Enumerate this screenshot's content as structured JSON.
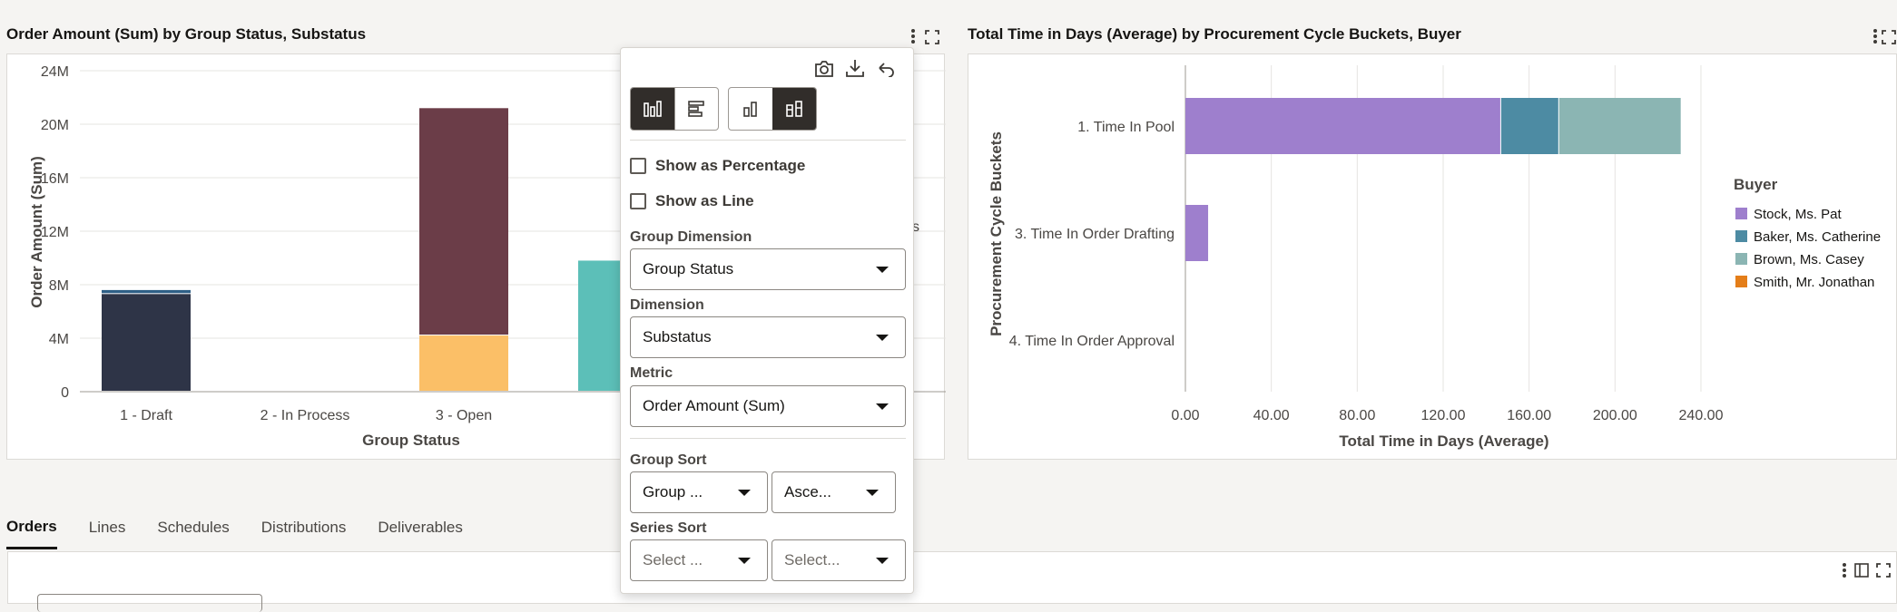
{
  "left_chart": {
    "title": "Order Amount (Sum) by Group Status, Substatus",
    "chart_data": {
      "type": "bar",
      "stacked": true,
      "title": "Order Amount (Sum) by Group Status, Substatus",
      "xlabel": "Group Status",
      "ylabel": "Order Amount (Sum)",
      "categories": [
        "1 - Draft",
        "2 - In Process",
        "3 - Open",
        ""
      ],
      "y_ticks": [
        "0",
        "4M",
        "8M",
        "12M",
        "16M",
        "20M",
        "24M"
      ],
      "ylim": [
        0,
        24000000
      ],
      "series": [
        {
          "color": "#2e3447",
          "values": [
            7300000,
            0,
            0,
            0
          ]
        },
        {
          "color": "#2e5f86",
          "values": [
            300000,
            0,
            0,
            0
          ]
        },
        {
          "color": "#fbbf67",
          "values": [
            0,
            0,
            4200000,
            0
          ]
        },
        {
          "color": "#6b3d48",
          "values": [
            0,
            0,
            17000000,
            0
          ]
        },
        {
          "color": "#5cbfb8",
          "values": [
            0,
            0,
            0,
            9800000
          ]
        }
      ],
      "grid": true
    },
    "legend_fragment": "s"
  },
  "right_chart": {
    "title": "Total Time in Days (Average) by Procurement Cycle Buckets, Buyer",
    "chart_data": {
      "type": "bar",
      "orientation": "horizontal",
      "stacked": true,
      "title": "Total Time in Days (Average) by Procurement Cycle Buckets, Buyer",
      "xlabel": "Total Time in Days (Average)",
      "ylabel": "Procurement Cycle Buckets",
      "categories": [
        "1. Time In Pool",
        "3. Time In Order Drafting",
        "4. Time In Order Approval"
      ],
      "x_ticks": [
        "0.00",
        "40.00",
        "80.00",
        "120.00",
        "160.00",
        "200.00",
        "240.00"
      ],
      "xlim": [
        0,
        240
      ],
      "legend_title": "Buyer",
      "legend_position": "right",
      "series": [
        {
          "name": "Stock, Ms. Pat",
          "color": "#9e7fcd",
          "values": [
            147,
            11,
            0
          ]
        },
        {
          "name": "Baker, Ms. Catherine",
          "color": "#4d8ba3",
          "values": [
            27,
            0,
            0
          ]
        },
        {
          "name": "Brown, Ms. Casey",
          "color": "#8bb5b3",
          "values": [
            57,
            0,
            0
          ]
        },
        {
          "name": "Smith, Mr. Jonathan",
          "color": "#e47e19",
          "values": [
            0,
            0,
            0
          ]
        }
      ],
      "grid": true
    }
  },
  "popup": {
    "show_as_percentage": "Show as Percentage",
    "show_as_line": "Show as Line",
    "group_dimension_label": "Group Dimension",
    "group_dimension_value": "Group Status",
    "dimension_label": "Dimension",
    "dimension_value": "Substatus",
    "metric_label": "Metric",
    "metric_value": "Order Amount (Sum)",
    "group_sort_label": "Group Sort",
    "group_sort_field": "Group ...",
    "group_sort_order": "Asce...",
    "series_sort_label": "Series Sort",
    "series_sort_field": "Select ...",
    "series_sort_order": "Select..."
  },
  "tabs": [
    "Orders",
    "Lines",
    "Schedules",
    "Distributions",
    "Deliverables"
  ],
  "active_tab": "Orders",
  "colors": {
    "accent_dark": "#312d2a",
    "page_bg": "#f5f4f2"
  },
  "icons": [
    "more-vertical-icon",
    "expand-icon",
    "camera-icon",
    "download-icon",
    "undo-icon",
    "vertical-bar-chart-icon",
    "horizontal-bar-chart-icon",
    "grouped-bar-icon",
    "stacked-bar-icon",
    "column-panel-icon"
  ]
}
